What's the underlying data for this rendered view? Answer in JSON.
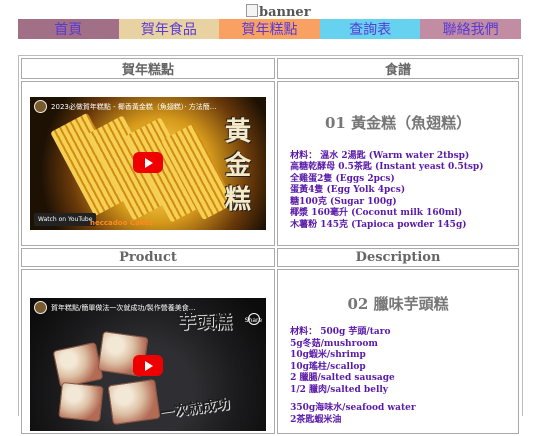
{
  "banner": {
    "alt": "banner"
  },
  "nav": [
    {
      "label": "首頁",
      "color": "#a16f86"
    },
    {
      "label": "賀年食品",
      "color": "#e9d2a1"
    },
    {
      "label": "賀年糕點",
      "color": "#f8a162"
    },
    {
      "label": "查詢表",
      "color": "#67d1f0"
    },
    {
      "label": "聯絡我們",
      "color": "#c28da3"
    }
  ],
  "table": {
    "header1": {
      "left": "賀年糕點",
      "right": "食譜"
    },
    "header2": {
      "left": "Product",
      "right": "Description"
    }
  },
  "items": [
    {
      "video_title": "2023必做賀年糕點 - 椰香黃金糕（魚翅糕）· 方法簡...",
      "video_overlay_text": "黃金糕",
      "watch_label": "Watch on YouTube",
      "caption": "neccadoo Cakes",
      "title": "01 黃金糕（魚翅糕）",
      "ingredients": [
        "材料：  溫水 2湯匙 (Warm water 2tbsp)",
        "高糖乾酵母 0.5茶匙 (Instant yeast 0.5tsp)",
        "全雞蛋2隻 (Eggs 2pcs)",
        "蛋黃4隻 (Egg Yolk 4pcs)",
        "糖100克 (Sugar 100g)",
        "椰漿 160毫升 (Coconut milk 160ml)",
        "木薯粉 145克 (Tapioca powder 145g)"
      ]
    },
    {
      "video_title": "賀年糕點/簡單做法一次就成功/製作營養美食...",
      "video_overlay_text": "芋頭糕",
      "video_overlay_text2": "一次就成功",
      "share_label": "Share",
      "title": "02 臘味芋頭糕",
      "ingredients": [
        "材料：  500g 芋頭/taro",
        "5g冬菇/mushroom",
        "10g蝦米/shrimp",
        "10g瑤柱/scallop",
        "2 臘腸/salted sausage",
        "1/2 臘肉/salted belly"
      ],
      "ingredients_extra": [
        "350g海味水/seafood water",
        "2茶匙蝦米油"
      ]
    }
  ]
}
